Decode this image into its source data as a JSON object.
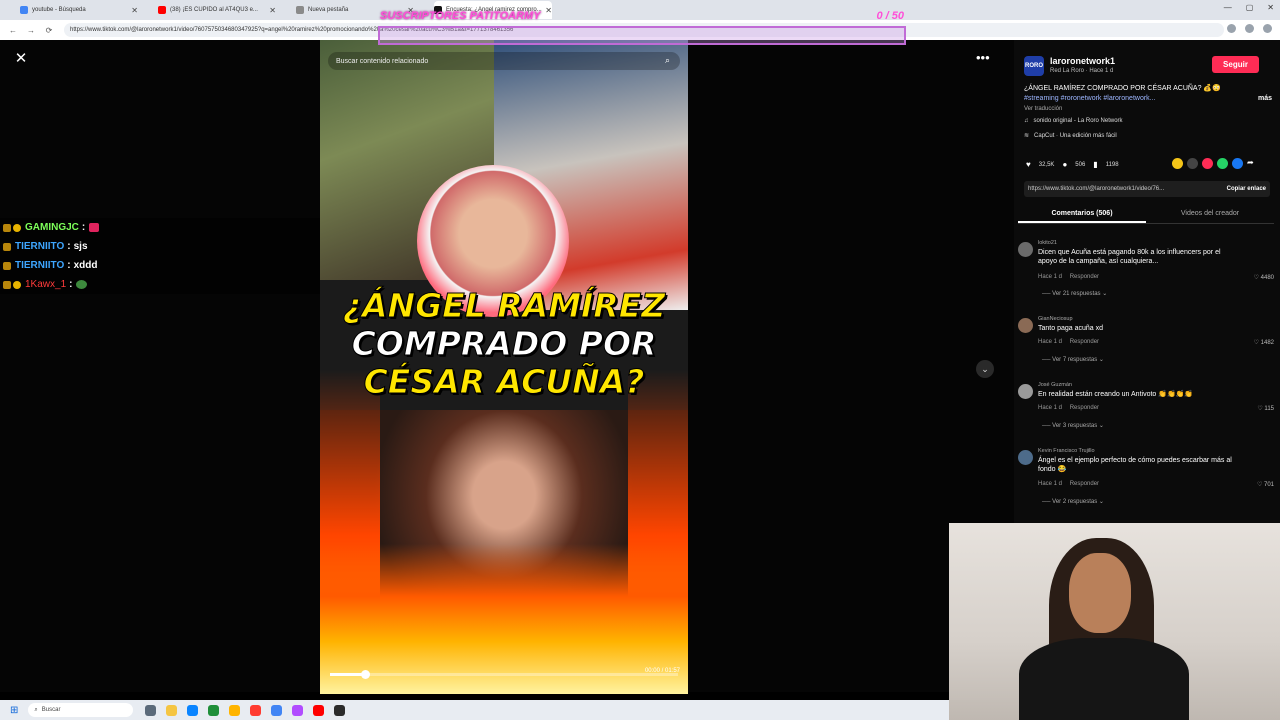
{
  "browser": {
    "tabs": [
      {
        "label": "youtube - Búsqueda",
        "favicon_color": "#4285f4"
      },
      {
        "label": "(38) ¡ES CUPIDO al AT4QU3 e...",
        "favicon_color": "#ff0000"
      },
      {
        "label": "Nueva pestaña",
        "favicon_color": "#8a8a8a"
      },
      {
        "label": "Encuesta: ¿Angel ramirez compro...",
        "favicon_color": "#111111"
      }
    ],
    "url": "https://www.tiktok.com/@laroronetwork1/video/7607575034680347925?q=angel%20ramirez%20promocionando%20a%20cesar%20acu%C3%B1a&t=1771378461356"
  },
  "overlay": {
    "subs_title": "SUSCRIPTORES PATITOARMY",
    "subs_count": "0 / 50"
  },
  "chat": [
    {
      "user": "GAMINGJC",
      "msg": "",
      "user_color": "#7dff5a",
      "emote_color": "#e0245e"
    },
    {
      "user": "TIERNIITO",
      "msg": "sjs",
      "user_color": "#3ea6ff",
      "emote_color": ""
    },
    {
      "user": "TIERNIITO",
      "msg": "xddd",
      "user_color": "#3ea6ff",
      "emote_color": ""
    },
    {
      "user": "1Kawx_1",
      "msg": "",
      "user_color": "#ff3b3b",
      "emote_color": "#3d8a3d"
    }
  ],
  "video": {
    "search_placeholder": "Buscar contenido relacionado",
    "headline_1": "¿ÁNGEL RAMÍREZ",
    "headline_2": "COMPRADO POR",
    "headline_3": "CÉSAR ACUÑA?",
    "time": "00:00 / 01:57",
    "progress": 0.1
  },
  "sidebar": {
    "account_name": "laroronetwork1",
    "account_sub": "Red La Roro · Hace 1 d",
    "avatar_text": "RORO",
    "follow_label": "Seguir",
    "description": "¿ÁNGEL RAMÍREZ COMPRADO POR CÉSAR ACUÑA? 💰😳",
    "hashtags": "#streaming #roronetwork #laroronetwork...",
    "more_label": "más",
    "translate_label": "Ver traducción",
    "sound": "sonido original - La Roro Network",
    "capcut": "CapCut · Una edición más fácil",
    "likes": "32,5K",
    "comments_count": "506",
    "saves": "1198",
    "link": "https://www.tiktok.com/@laroronetwork1/video/76...",
    "copy_label": "Copiar enlace",
    "tab_comments": "Comentarios (506)",
    "tab_creator": "Videos del creador"
  },
  "comments": [
    {
      "user": "lokito21",
      "text": "Dicen que Acuña está pagando 80k a los influencers por el apoyo de la campaña, así cualquiera...",
      "time": "Hace 1 d",
      "reply": "Responder",
      "likes": "4480",
      "replies": "Ver 21 respuestas"
    },
    {
      "user": "GianNeciosup",
      "text": "Tanto paga acuña xd",
      "time": "Hace 1 d",
      "reply": "Responder",
      "likes": "1482",
      "replies": "Ver 7 respuestas"
    },
    {
      "user": "José Guzmán",
      "text": "En realidad están creando un Antivoto 👏👏👏👏",
      "time": "Hace 1 d",
      "reply": "Responder",
      "likes": "115",
      "replies": "Ver 3 respuestas"
    },
    {
      "user": "Kevin Francisco Trujillo",
      "text": "Ángel es el ejemplo perfecto de cómo puedes escarbar más al fondo 😂",
      "time": "Hace 1 d",
      "reply": "Responder",
      "likes": "701",
      "replies": "Ver 2 respuestas"
    }
  ],
  "taskbar": {
    "search_placeholder": "Buscar",
    "app_colors": [
      "#5b6a7a",
      "#f5c542",
      "#0a84ff",
      "#1f8f3a",
      "#ffb400",
      "#ff3b30",
      "#4285f4",
      "#b14cff",
      "#ff0000",
      "#2b2b2b"
    ]
  }
}
